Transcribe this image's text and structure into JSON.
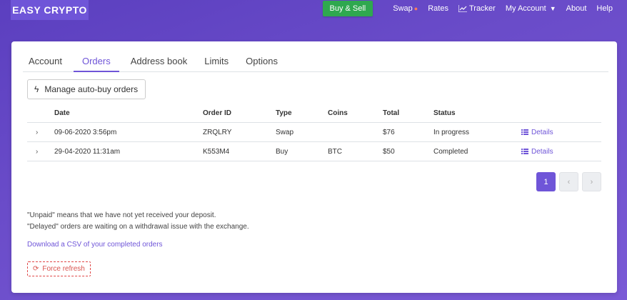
{
  "navbar": {
    "logo": "EASY CRYPTO",
    "buy_sell": "Buy & Sell",
    "links": {
      "swap": "Swap",
      "rates": "Rates",
      "tracker": "Tracker",
      "my_account": "My Account",
      "about": "About",
      "help": "Help"
    },
    "swap_icon": "drop-icon",
    "tracker_icon": "chart-line-icon",
    "my_account_icon": "chevron-down-icon",
    "accent_color": "#6f55d8",
    "buy_sell_color": "#2fa84f"
  },
  "tabs": [
    "Account",
    "Orders",
    "Address book",
    "Limits",
    "Options"
  ],
  "active_tab": "Orders",
  "auto_buy_button": "Manage auto-buy orders",
  "table": {
    "headers": {
      "date": "Date",
      "order_id": "Order ID",
      "type": "Type",
      "coins": "Coins",
      "total": "Total",
      "status": "Status"
    },
    "rows": [
      {
        "date": "09-06-2020 3:56pm",
        "order_id": "ZRQLRY",
        "type": "Swap",
        "coins": "",
        "total": "$76",
        "status": "In progress",
        "details": "Details"
      },
      {
        "date": "29-04-2020 11:31am",
        "order_id": "K553M4",
        "type": "Buy",
        "coins": "BTC",
        "total": "$50",
        "status": "Completed",
        "details": "Details"
      }
    ]
  },
  "pagination": {
    "current": "1",
    "prev": "‹",
    "next": "›"
  },
  "notes": {
    "unpaid": "\"Unpaid\" means that we have not yet received your deposit.",
    "delayed": "\"Delayed\" orders are waiting on a withdrawal issue with the exchange."
  },
  "csv_link": "Download a CSV of your completed orders",
  "refresh_button": "Force refresh"
}
